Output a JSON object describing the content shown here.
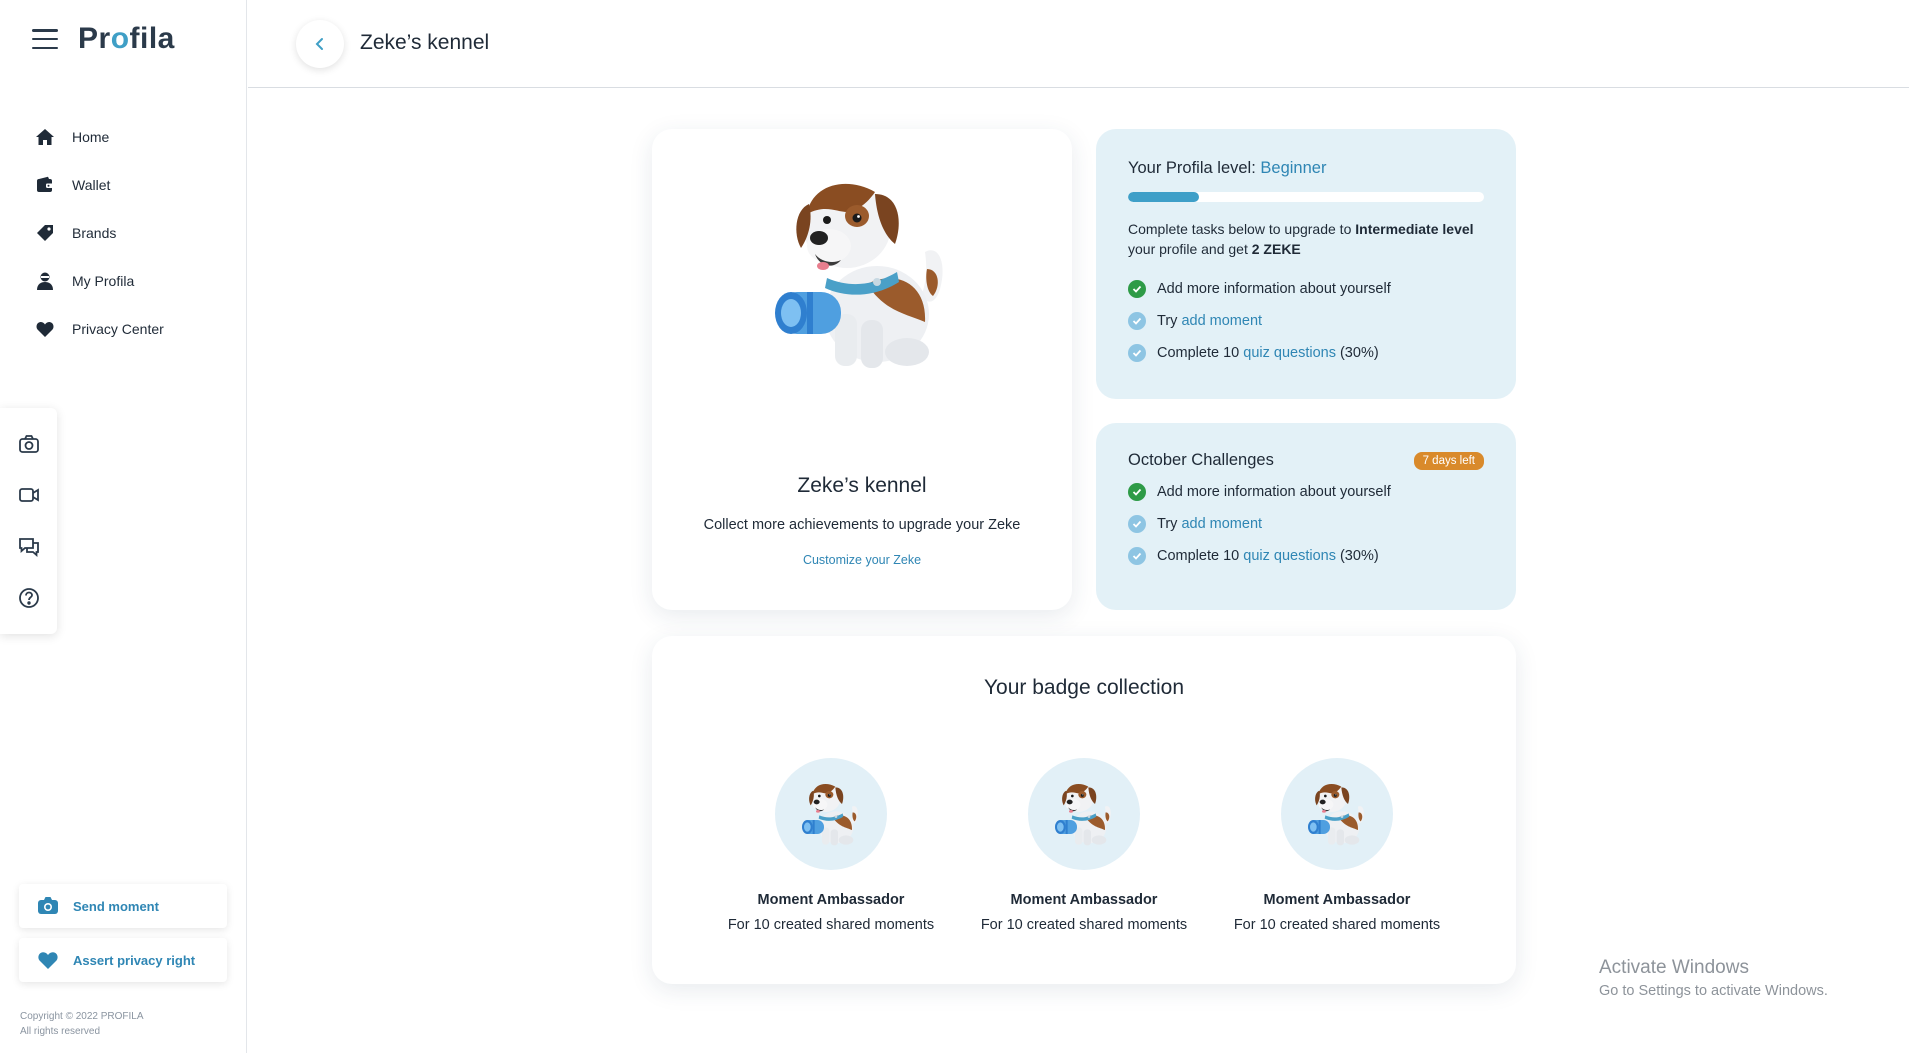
{
  "app": {
    "logo_text_pre": "Pr",
    "logo_text_o": "o",
    "logo_text_post": "fila",
    "brand_color": "#3f9fc6"
  },
  "sidebar": {
    "items": [
      {
        "label": "Home",
        "icon": "home-icon"
      },
      {
        "label": "Wallet",
        "icon": "wallet-icon"
      },
      {
        "label": "Brands",
        "icon": "tag-icon"
      },
      {
        "label": "My Profila",
        "icon": "user-icon"
      },
      {
        "label": "Privacy Center",
        "icon": "heart-shield-icon"
      }
    ],
    "quick_actions": [
      "camera-icon",
      "video-icon",
      "chat-icon",
      "help-icon"
    ],
    "send_moment": "Send moment",
    "assert_privacy": "Assert privacy right",
    "copyright_line1": "Copyright © 2022 PROFILA",
    "copyright_line2": "All rights reserved"
  },
  "header": {
    "title": "Zeke’s kennel"
  },
  "kennel": {
    "title": "Zeke’s kennel",
    "subtitle": "Collect more achievements to upgrade your Zeke",
    "customize_link": "Customize your Zeke"
  },
  "level": {
    "label": "Your Profila level: ",
    "value": "Beginner",
    "progress_fraction": 0.2,
    "desc_pre": "Complete tasks below to upgrade to ",
    "desc_bold": "Intermediate level",
    "desc_mid": " your profile and get ",
    "desc_reward": "2 ZEKE",
    "tasks": [
      {
        "pre": "Add more information about yourself",
        "link": "",
        "post": "",
        "status": "done"
      },
      {
        "pre": "Try ",
        "link": "add moment",
        "post": "",
        "status": "pending"
      },
      {
        "pre": "Complete 10 ",
        "link": "quiz questions",
        "post": " (30%)",
        "status": "pending"
      }
    ]
  },
  "challenges": {
    "title": "October Challenges",
    "badge": "7 days left",
    "badge_color": "#d98a2b",
    "tasks": [
      {
        "pre": "Add more information about yourself",
        "link": "",
        "post": "",
        "status": "done"
      },
      {
        "pre": "Try ",
        "link": "add moment",
        "post": "",
        "status": "pending"
      },
      {
        "pre": "Complete 10 ",
        "link": "quiz questions",
        "post": " (30%)",
        "status": "pending"
      }
    ]
  },
  "badges": {
    "heading": "Your badge collection",
    "items": [
      {
        "name": "Moment Ambassador",
        "desc": "For 10 created shared moments"
      },
      {
        "name": "Moment Ambassador",
        "desc": "For 10 created shared moments"
      },
      {
        "name": "Moment Ambassador",
        "desc": "For 10 created shared moments"
      }
    ]
  },
  "watermark": {
    "line1": "Activate Windows",
    "line2": "Go to Settings to activate Windows."
  }
}
